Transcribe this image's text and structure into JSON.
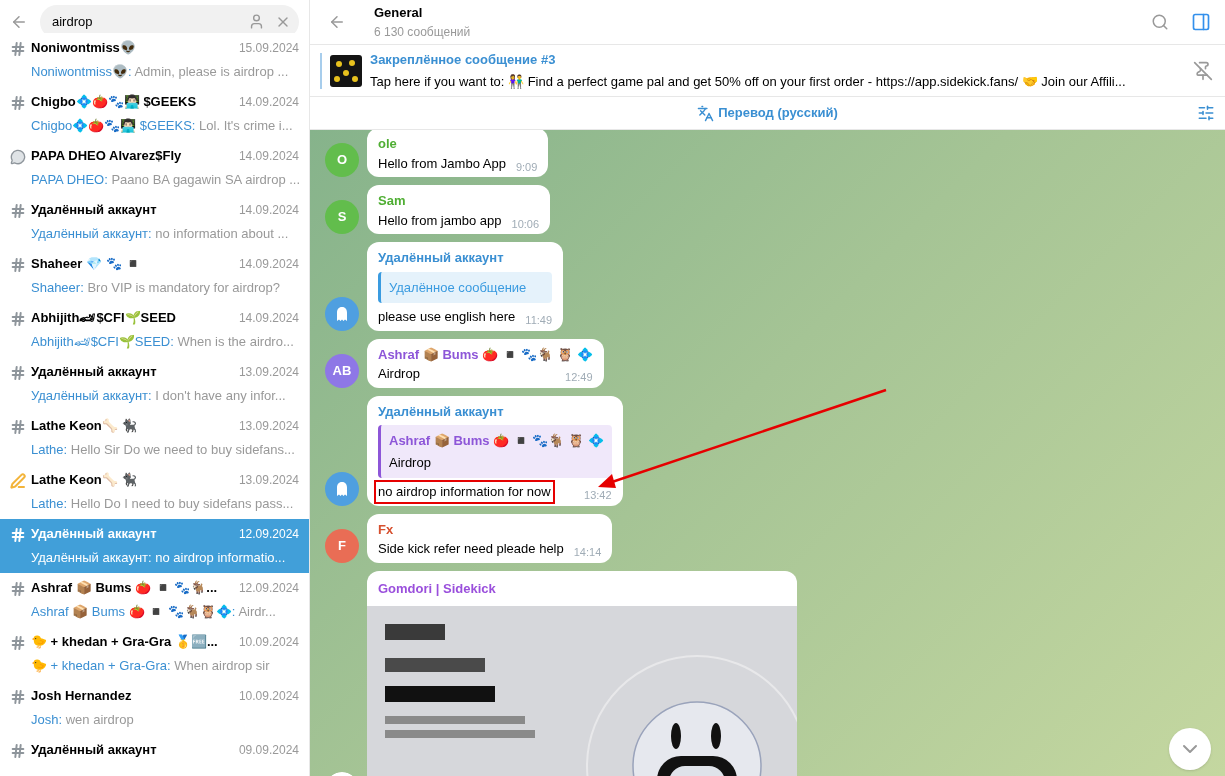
{
  "search": {
    "value": "airdrop"
  },
  "chats": [
    {
      "kind": "hash",
      "name": "Noniwontmiss👽",
      "date": "15.09.2024",
      "sender": "Noniwontmiss👽:",
      "preview": " Admin, please is airdrop ...",
      "selected": false
    },
    {
      "kind": "hash",
      "name": "Chigbo💠🍅🐾👨🏻‍💻 $GEEKS",
      "date": "14.09.2024",
      "sender": "Chigbo💠🍅🐾👨🏻‍💻 $GEEKS:",
      "preview": " Lol. It's crime i...",
      "selected": false
    },
    {
      "kind": "bubble",
      "name": "PAPA DHEO Alvarez$Fly",
      "date": "14.09.2024",
      "sender": "PAPA DHEO:",
      "preview": " Paano BA gagawin SA airdrop ...",
      "selected": false
    },
    {
      "kind": "hash",
      "name": "Удалённый аккаунт",
      "date": "14.09.2024",
      "sender": "Удалённый аккаунт:",
      "preview": " no information about ...",
      "selected": false
    },
    {
      "kind": "hash",
      "name": "Shaheer 💎 🐾 ◾",
      "date": "14.09.2024",
      "sender": "Shaheer:",
      "preview": " Bro VIP is mandatory for airdrop?",
      "selected": false
    },
    {
      "kind": "hash",
      "name": "Abhijith🏎$CFI🌱SEED",
      "date": "14.09.2024",
      "sender": "Abhijith🏎$CFI🌱SEED:",
      "preview": " When is the airdro...",
      "selected": false
    },
    {
      "kind": "hash",
      "name": "Удалённый аккаунт",
      "date": "13.09.2024",
      "sender": "Удалённый аккаунт:",
      "preview": " I don't have any infor...",
      "selected": false
    },
    {
      "kind": "hash",
      "name": "Lathe Keon🦴 🐈‍⬛",
      "date": "13.09.2024",
      "sender": "Lathe:",
      "preview": " Hello Sir  Do we need to buy sidefans...",
      "selected": false
    },
    {
      "kind": "pen",
      "name": "Lathe Keon🦴 🐈‍⬛",
      "date": "13.09.2024",
      "sender": "Lathe:",
      "preview": " Hello  Do I need to buy sidefans pass...",
      "selected": false
    },
    {
      "kind": "hash",
      "name": "Удалённый аккаунт",
      "date": "12.09.2024",
      "sender": "Удалённый аккаунт:",
      "preview": " no airdrop informatio...",
      "selected": true
    },
    {
      "kind": "hash",
      "name": "Ashraf 📦 Bums 🍅 ◾ 🐾🐐...",
      "date": "12.09.2024",
      "sender": "Ashraf 📦 Bums 🍅 ◾ 🐾🐐🦉💠:",
      "preview": " Airdr...",
      "selected": false
    },
    {
      "kind": "hash",
      "name": "🐤 + khedan + Gra-Gra 🥇🆓...",
      "date": "10.09.2024",
      "sender": "🐤 + khedan + Gra-Gra:",
      "preview": " When airdrop sir",
      "selected": false
    },
    {
      "kind": "hash",
      "name": "Josh Hernandez",
      "date": "10.09.2024",
      "sender": "Josh:",
      "preview": " wen airdrop",
      "selected": false
    },
    {
      "kind": "hash",
      "name": "Удалённый аккаунт",
      "date": "09.09.2024",
      "selected": false
    }
  ],
  "header": {
    "title": "General",
    "subtitle": "6 130 сообщений"
  },
  "pinned": {
    "title": "Закреплённое сообщение #3",
    "text": "Tap here if you want to:  👫 Find a perfect game pal and get 50% off on your first order - https://app.sidekick.fans/  🤝 Join our Affili..."
  },
  "translate": {
    "label": "Перевод (русский)"
  },
  "messages": [
    {
      "sender": "ole",
      "color": "#4fae33",
      "avatar": {
        "kind": "letter",
        "text": "O",
        "color": "#62bd4c"
      },
      "text": "Hello from Jambo App",
      "time": "9:09"
    },
    {
      "sender": "Sam",
      "color": "#4fae33",
      "avatar": {
        "kind": "letter",
        "text": "S",
        "color": "#62bd4c"
      },
      "text": "Hello from jambo app",
      "time": "10:06"
    },
    {
      "sender": "Удалённый аккаунт",
      "color": "#3a8fd2",
      "avatar": {
        "kind": "ghost",
        "color": "#4f9fe0"
      },
      "reply": {
        "title": "Удалённое сообщение",
        "color": "#3a9be0"
      },
      "text": "please use english here",
      "time": "11:49"
    },
    {
      "sender": "Ashraf 📦 Bums 🍅 ◾ 🐾🐐 🦉 💠",
      "color": "#8d56d8",
      "avatar": {
        "kind": "letter",
        "text": "AB",
        "color": "#8e77e6"
      },
      "text": "Airdrop",
      "time": "12:49"
    },
    {
      "sender": "Удалённый аккаунт",
      "color": "#3a8fd2",
      "avatar": {
        "kind": "ghost",
        "color": "#4f9fe0"
      },
      "reply": {
        "title": "Ashraf 📦 Bums 🍅 ◾ 🐾🐐 🦉 💠",
        "text": "Airdrop",
        "color": "#8d56d8"
      },
      "text": "no airdrop information for now",
      "time": "13:42",
      "highlighted": true
    },
    {
      "sender": "Fx",
      "color": "#d6502f",
      "avatar": {
        "kind": "letter",
        "text": "F",
        "color": "#e96d55"
      },
      "text": "Side kick refer need pleade help",
      "time": "14:14"
    },
    {
      "sender": "Gomdori | Sidekick",
      "color": "#9a4fdc"
    }
  ]
}
